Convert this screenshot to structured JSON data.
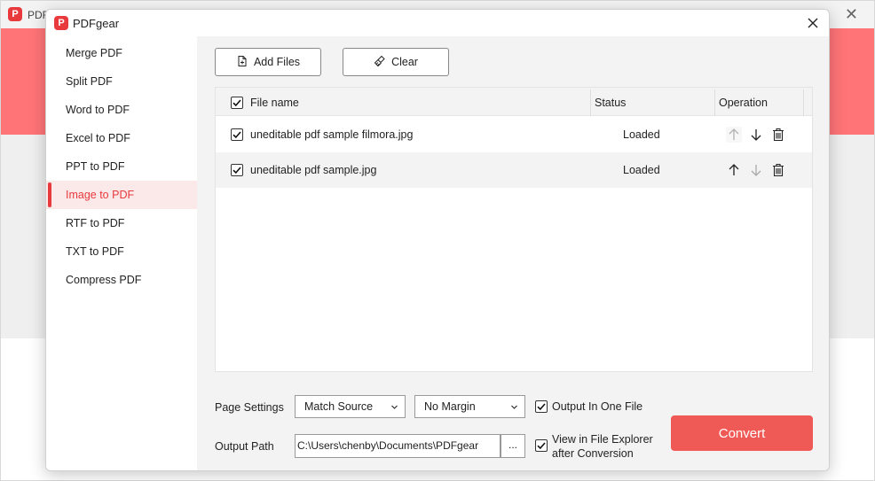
{
  "background_app": {
    "title": "PDF",
    "logo": "pdfgear-logo"
  },
  "dialog": {
    "title": "PDFgear",
    "close_icon": "close-icon"
  },
  "sidebar": {
    "items": [
      {
        "label": "Merge PDF",
        "active": false
      },
      {
        "label": "Split PDF",
        "active": false
      },
      {
        "label": "Word to PDF",
        "active": false
      },
      {
        "label": "Excel to PDF",
        "active": false
      },
      {
        "label": "PPT to PDF",
        "active": false
      },
      {
        "label": "Image to PDF",
        "active": true
      },
      {
        "label": "RTF to PDF",
        "active": false
      },
      {
        "label": "TXT to PDF",
        "active": false
      },
      {
        "label": "Compress PDF",
        "active": false
      }
    ]
  },
  "toolbar": {
    "add_files_label": "Add Files",
    "clear_label": "Clear"
  },
  "file_list": {
    "columns": {
      "name": "File name",
      "status": "Status",
      "operation": "Operation"
    },
    "select_all_checked": true,
    "rows": [
      {
        "name": "uneditable pdf sample filmora.jpg",
        "status": "Loaded",
        "checked": true
      },
      {
        "name": "uneditable pdf sample.jpg",
        "status": "Loaded",
        "checked": true
      }
    ]
  },
  "settings": {
    "page_settings_label": "Page Settings",
    "page_size_value": "Match Source",
    "margin_value": "No Margin",
    "output_one_file_label": "Output In One File",
    "output_one_file_checked": true,
    "output_path_label": "Output Path",
    "output_path_value": "C:\\Users\\chenby\\Documents\\PDFgear",
    "browse_label": "...",
    "view_explorer_label_1": "View in File Explorer",
    "view_explorer_label_2": "after Conversion",
    "view_explorer_checked": true
  },
  "convert_label": "Convert",
  "colors": {
    "accent": "#f05a56",
    "brand_red": "#e8393d",
    "hero": "#ff7477"
  }
}
